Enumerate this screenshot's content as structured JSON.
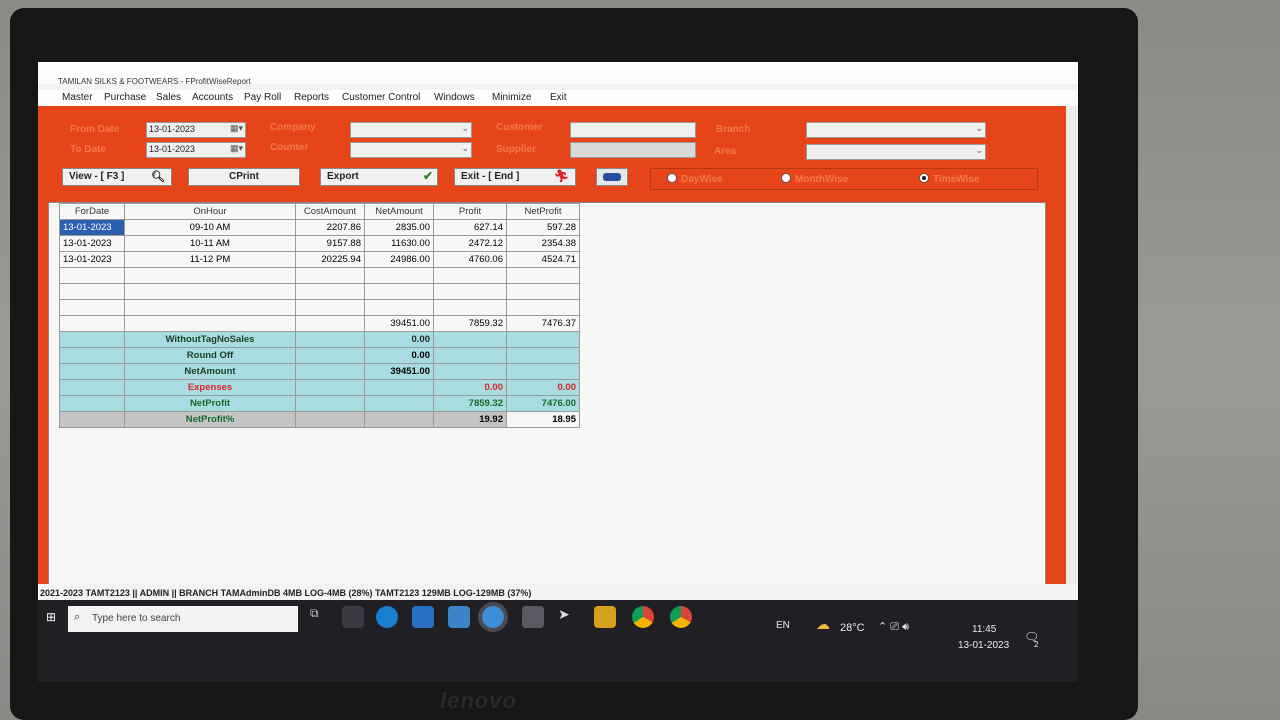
{
  "window": {
    "title": "TAMILAN SILKS & FOOTWEARS - FProfitWiseReport"
  },
  "menu": [
    "Master",
    "Purchase",
    "Sales",
    "Accounts",
    "Pay Roll",
    "Reports",
    "Customer Control",
    "Windows",
    "Minimize",
    "Exit"
  ],
  "filters": {
    "from_date_label": "From Date",
    "from_date": "13-01-2023",
    "to_date_label": "To Date",
    "to_date": "13-01-2023",
    "company_label": "Company",
    "counter_label": "Counter",
    "customer_label": "Customer",
    "supplier_label": "Supplier",
    "branch_label": "Branch",
    "area_label": "Area"
  },
  "buttons": {
    "view": "View - [ F3 ]",
    "cprint": "CPrint",
    "export": "Export",
    "exit": "Exit - [ End ]"
  },
  "radios": {
    "daywise": "DayWise",
    "monthwise": "MonthWise",
    "timewise": "TimeWise",
    "selected": "timewise"
  },
  "grid": {
    "headers": [
      "ForDate",
      "OnHour",
      "CostAmount",
      "NetAmount",
      "Profit",
      "NetProfit"
    ],
    "rows": [
      [
        "13-01-2023",
        "09-10 AM",
        "2207.86",
        "2835.00",
        "627.14",
        "597.28"
      ],
      [
        "13-01-2023",
        "10-11 AM",
        "9157.88",
        "11630.00",
        "2472.12",
        "2354.38"
      ],
      [
        "13-01-2023",
        "11-12 PM",
        "20225.94",
        "24986.00",
        "4760.06",
        "4524.71"
      ]
    ],
    "totals": {
      "net_amount": "39451.00",
      "profit": "7859.32",
      "net_profit": "7476.37"
    },
    "summary": {
      "without_tag_label": "WithoutTagNoSales",
      "without_tag": "0.00",
      "round_off_label": "Round Off",
      "round_off": "0.00",
      "net_amount_label": "NetAmount",
      "net_amount": "39451.00",
      "expenses_label": "Expenses",
      "expenses_profit": "0.00",
      "expenses_net": "0.00",
      "net_profit_label": "NetProfit",
      "net_profit_profit": "7859.32",
      "net_profit_net": "7476.00",
      "net_profit_pct_label": "NetProfit%",
      "pct_profit": "19.92",
      "pct_net": "18.95"
    }
  },
  "status": {
    "text": "2021-2023  TAMT2123  ||  ADMIN  ||  BRANCH  TAMAdminDB  4MB LOG-4MB (28%)  TAMT2123  129MB LOG-129MB (37%)"
  },
  "taskbar": {
    "search_placeholder": "Type here to search",
    "lang": "EN",
    "temp": "28°C",
    "time": "11:45",
    "date": "13-01-2023",
    "notif": "2"
  },
  "monitor": {
    "brand": "lenovo"
  }
}
